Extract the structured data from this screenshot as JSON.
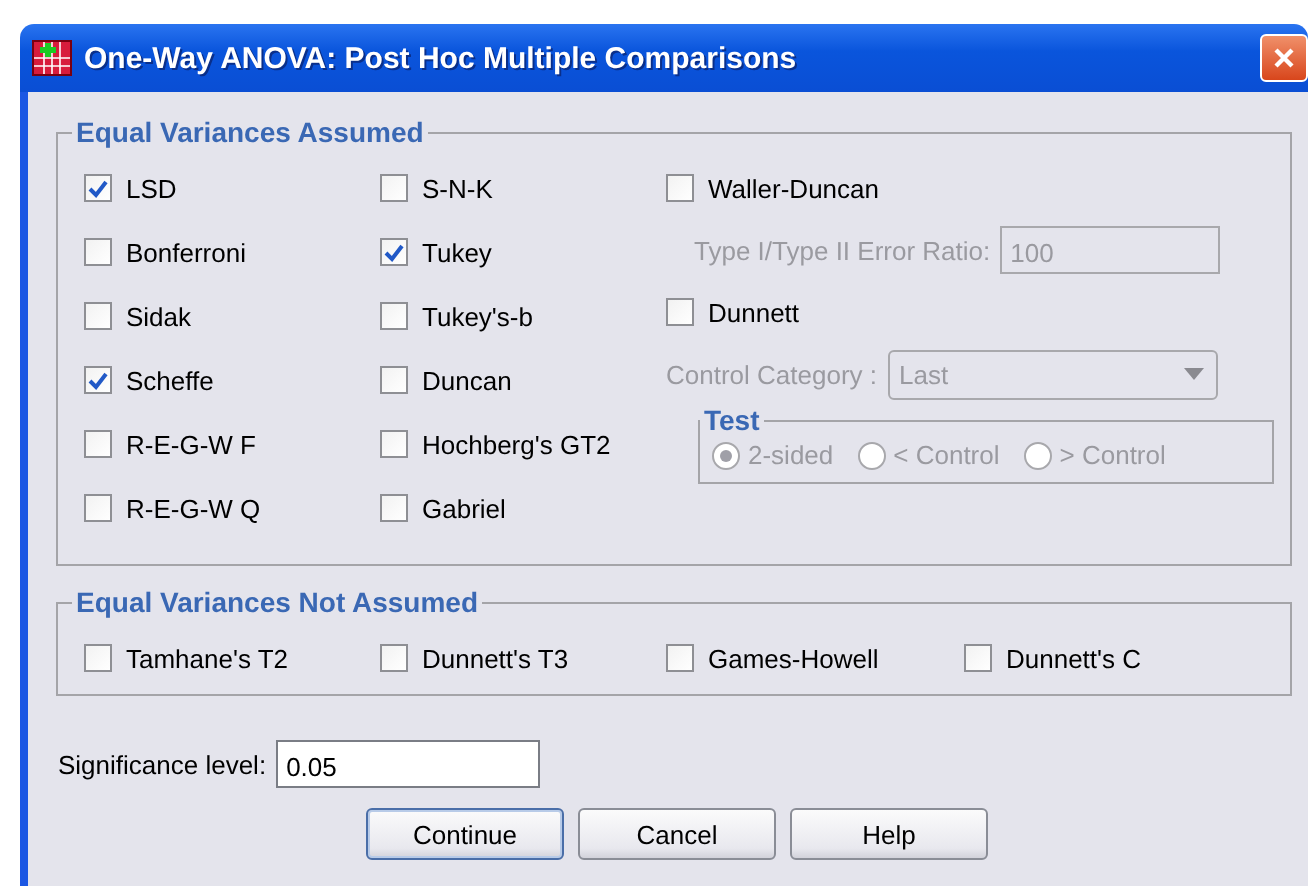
{
  "window": {
    "title": "One-Way ANOVA: Post Hoc Multiple Comparisons"
  },
  "equal_variances_assumed": {
    "title": "Equal Variances Assumed",
    "column_1": [
      {
        "label": "LSD",
        "checked": true
      },
      {
        "label": "Bonferroni",
        "checked": false
      },
      {
        "label": "Sidak",
        "checked": false
      },
      {
        "label": "Scheffe",
        "checked": true
      },
      {
        "label": "R-E-G-W F",
        "checked": false
      },
      {
        "label": "R-E-G-W Q",
        "checked": false
      }
    ],
    "column_2": [
      {
        "label": "S-N-K",
        "checked": false
      },
      {
        "label": "Tukey",
        "checked": true
      },
      {
        "label": "Tukey's-b",
        "checked": false
      },
      {
        "label": "Duncan",
        "checked": false
      },
      {
        "label": "Hochberg's GT2",
        "checked": false
      },
      {
        "label": "Gabriel",
        "checked": false
      }
    ],
    "waller_duncan": {
      "label": "Waller-Duncan",
      "checked": false
    },
    "error_ratio": {
      "label": "Type I/Type II Error Ratio:",
      "value": "100",
      "disabled": true
    },
    "dunnett": {
      "label": "Dunnett",
      "checked": false
    },
    "control_category": {
      "label": "Control Category :",
      "value": "Last",
      "disabled": true
    },
    "test": {
      "title": "Test",
      "disabled": true,
      "options": [
        {
          "label": "2-sided",
          "selected": true
        },
        {
          "label": "< Control",
          "selected": false
        },
        {
          "label": "> Control",
          "selected": false
        }
      ]
    }
  },
  "equal_variances_not_assumed": {
    "title": "Equal Variances Not Assumed",
    "options": [
      {
        "label": "Tamhane's T2",
        "checked": false
      },
      {
        "label": "Dunnett's T3",
        "checked": false
      },
      {
        "label": "Games-Howell",
        "checked": false
      },
      {
        "label": "Dunnett's C",
        "checked": false
      }
    ]
  },
  "significance": {
    "label": "Significance level:",
    "value": "0.05"
  },
  "buttons": [
    {
      "label": "Continue",
      "default": true
    },
    {
      "label": "Cancel",
      "default": false
    },
    {
      "label": "Help",
      "default": false
    }
  ]
}
